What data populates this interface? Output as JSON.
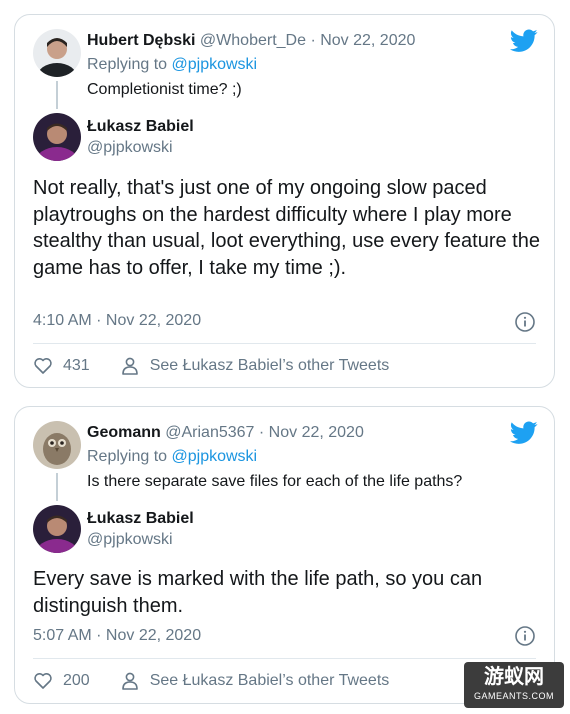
{
  "tweets": [
    {
      "parent": {
        "name": "Hubert Dębski",
        "handle": "@Whobert_De",
        "separator": "·",
        "date": "Nov 22, 2020",
        "replying_prefix": "Replying to",
        "replying_to": "@pjpkowski",
        "text": "Completionist time? ;)"
      },
      "main": {
        "name": "Łukasz Babiel",
        "handle": "@pjpkowski",
        "text": "Not really, that's just one of my ongoing slow paced playtroughs on the hardest difficulty where I play more stealthy than usual, loot everything, use every feature the game has to offer, I take my time ;).",
        "timestamp": "4:10 AM · Nov 22, 2020",
        "likes": "431",
        "see_other": "See Łukasz Babiel’s other Tweets"
      }
    },
    {
      "parent": {
        "name": "Geomann",
        "handle": "@Arian5367",
        "separator": "·",
        "date": "Nov 22, 2020",
        "replying_prefix": "Replying to",
        "replying_to": "@pjpkowski",
        "text": "Is there separate save files for each of the life paths?"
      },
      "main": {
        "name": "Łukasz Babiel",
        "handle": "@pjpkowski",
        "text": "Every save is marked with the life path, so you can distinguish them.",
        "timestamp": "5:07 AM · Nov 22, 2020",
        "likes": "200",
        "see_other": "See Łukasz Babiel’s other Tweets"
      }
    }
  ],
  "watermark": {
    "main": "游蚁网",
    "sub": "GAMEANTS.COM"
  },
  "icons": {
    "brand": "twitter-bird-icon",
    "info": "info-icon",
    "like": "heart-icon",
    "profile": "person-icon"
  },
  "colors": {
    "twitter_blue": "#1da1f2",
    "link": "#1b95e0",
    "muted": "#657786",
    "border": "#d6dde2"
  }
}
